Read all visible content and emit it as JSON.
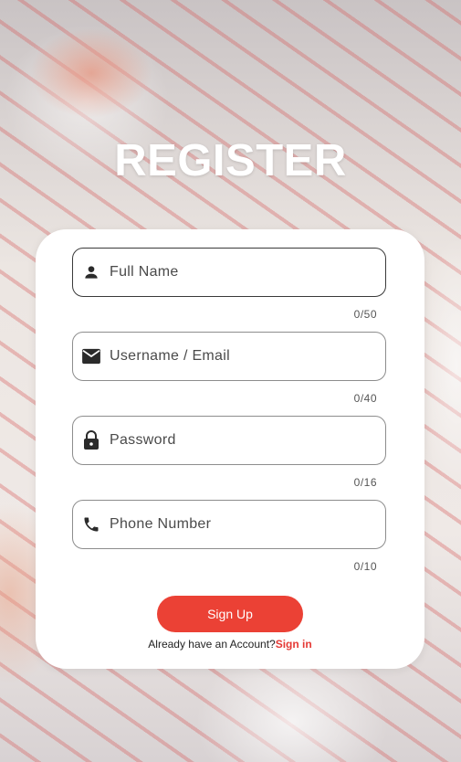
{
  "page": {
    "title": "REGISTER"
  },
  "form": {
    "fields": [
      {
        "placeholder": "Full Name",
        "value": "",
        "counter": "0/50",
        "icon": "person-icon"
      },
      {
        "placeholder": "Username / Email",
        "value": "",
        "counter": "0/40",
        "icon": "email-icon"
      },
      {
        "placeholder": "Password",
        "value": "",
        "counter": "0/16",
        "icon": "lock-icon"
      },
      {
        "placeholder": "Phone Number",
        "value": "",
        "counter": "0/10",
        "icon": "phone-icon"
      }
    ],
    "submit_label": "Sign Up",
    "signin_prompt": "Already have an Account?",
    "signin_link": "Sign in"
  },
  "colors": {
    "accent": "#eb4135",
    "link": "#e53935",
    "card": "#ffffff",
    "title": "#ffffff"
  }
}
